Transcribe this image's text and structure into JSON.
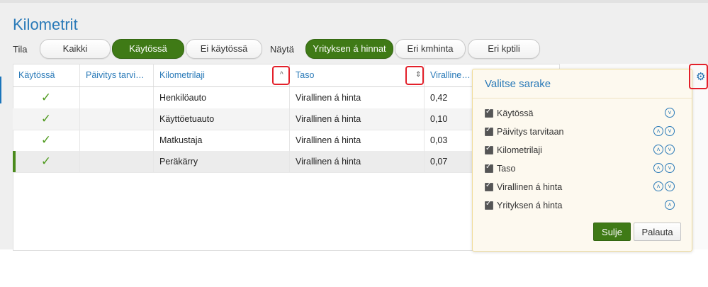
{
  "page": {
    "title": "Kilometrit"
  },
  "filters": {
    "tila_label": "Tila",
    "tila_options": [
      "Kaikki",
      "Käytössä",
      "Ei käytössä"
    ],
    "tila_selected": "Käytössä",
    "nayta_label": "Näytä",
    "nayta_options": [
      "Yrityksen á hinnat",
      "Eri kmhinta",
      "Eri kptili"
    ],
    "nayta_selected": "Yrityksen á hinnat"
  },
  "table": {
    "headers": [
      "Käytössä",
      "Päivitys tarvi…",
      "Kilometrilaji",
      "Taso",
      "Virallinen á"
    ],
    "rows": [
      {
        "kaytossa": "✓",
        "paivitys": "",
        "laji": "Henkilöauto",
        "taso": "Virallinen á hinta",
        "virallinen": "0,42"
      },
      {
        "kaytossa": "✓",
        "paivitys": "",
        "laji": "Käyttöetuauto",
        "taso": "Virallinen á hinta",
        "virallinen": "0,10"
      },
      {
        "kaytossa": "✓",
        "paivitys": "",
        "laji": "Matkustaja",
        "taso": "Virallinen á hinta",
        "virallinen": "0,03"
      },
      {
        "kaytossa": "✓",
        "paivitys": "",
        "laji": "Peräkärry",
        "taso": "Virallinen á hinta",
        "virallinen": "0,07"
      }
    ],
    "icons": {
      "sort_asc": "chevron-up-icon",
      "sort_both": "sort-icon",
      "settings": "gear-icon"
    }
  },
  "column_chooser": {
    "title": "Valitse sarake",
    "columns": [
      {
        "label": "Käytössä",
        "checked": true
      },
      {
        "label": "Päivitys tarvitaan",
        "checked": true
      },
      {
        "label": "Kilometrilaji",
        "checked": true
      },
      {
        "label": "Taso",
        "checked": true
      },
      {
        "label": "Virallinen á hinta",
        "checked": true
      },
      {
        "label": "Yrityksen á hinta",
        "checked": true
      }
    ],
    "close_label": "Sulje",
    "reset_label": "Palauta"
  },
  "colors": {
    "accent": "#2a7ab8",
    "primary_button": "#3f7a16",
    "highlight": "#e3202a"
  }
}
